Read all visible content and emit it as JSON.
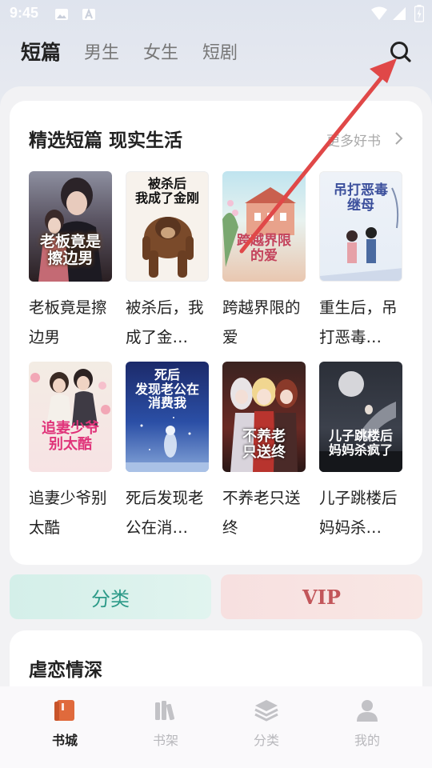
{
  "status_bar": {
    "time": "9:45"
  },
  "top_tabs": [
    {
      "label": "短篇",
      "active": true
    },
    {
      "label": "男生",
      "active": false
    },
    {
      "label": "女生",
      "active": false
    },
    {
      "label": "短剧",
      "active": false
    }
  ],
  "section": {
    "title": "精选短篇 现实生活",
    "more_label": "更多好书",
    "books": [
      {
        "name": "老板竟是擦边男",
        "cover_text": "老板竟是擦边男"
      },
      {
        "name": "被杀后，我成了金…",
        "cover_text": "被杀后我成了金刚"
      },
      {
        "name": "跨越界限的爱",
        "cover_text": "跨越界限的爱"
      },
      {
        "name": "重生后，吊打恶毒…",
        "cover_text": "吊打恶毒继母"
      },
      {
        "name": "追妻少爷别太酷",
        "cover_text": "追妻少爷别太酷"
      },
      {
        "name": "死后发现老公在消…",
        "cover_text": "死后发现老公在消费我"
      },
      {
        "name": "不养老只送终",
        "cover_text": "不养老只送终"
      },
      {
        "name": "儿子跳楼后妈妈杀…",
        "cover_text": "儿子跳楼后妈妈杀疯了"
      }
    ]
  },
  "quick_buttons": {
    "category": "分类",
    "vip": "VIP"
  },
  "section2": {
    "title": "虐恋情深"
  },
  "bottom_nav": [
    {
      "label": "书城",
      "icon": "book-icon",
      "active": true
    },
    {
      "label": "书架",
      "icon": "bookshelf-icon",
      "active": false
    },
    {
      "label": "分类",
      "icon": "layers-icon",
      "active": false
    },
    {
      "label": "我的",
      "icon": "person-icon",
      "active": false
    }
  ],
  "colors": {
    "accent": "#e06a3c",
    "category_text": "#2c9a88",
    "vip_text": "#c2565a",
    "annotation_arrow": "#e04848"
  }
}
